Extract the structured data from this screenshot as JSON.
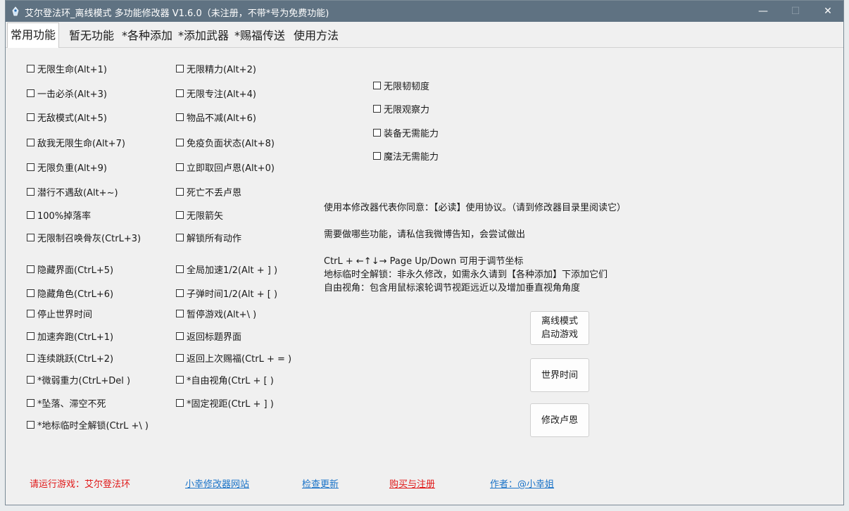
{
  "window": {
    "title": "艾尔登法环_离线模式 多功能修改器  V1.6.0（未注册，不带*号为免费功能)",
    "icon": "app-icon",
    "controls": {
      "minimize": "—",
      "maximize": "☐",
      "close": "✕"
    },
    "colors": {
      "titlebar": "#5f7282",
      "link": "#1a73c8",
      "warn": "#e01818"
    }
  },
  "tabs": [
    {
      "label": "常用功能",
      "active": true
    },
    {
      "label": "暂无功能"
    },
    {
      "label": "*各种添加"
    },
    {
      "label": "*添加武器"
    },
    {
      "label": "*赐福传送"
    },
    {
      "label": "使用方法"
    }
  ],
  "col1": [
    "无限生命(Alt+1)",
    "一击必杀(Alt+3)",
    "无敌模式(Alt+5)",
    "敌我无限生命(Alt+7)",
    "无限负重(Alt+9)",
    "潜行不遇敌(Alt+~)",
    "100%掉落率",
    "无限制召唤骨灰(CtrL+3)",
    "隐藏界面(CtrL+5)",
    "隐藏角色(CtrL+6)",
    "停止世界时间",
    "加速奔跑(CtrL+1)",
    "连续跳跃(CtrL+2)",
    "*微弱重力(CtrL+Del )",
    "*坠落、滞空不死",
    "*地标临时全解锁(CtrL +\\ )"
  ],
  "col2": [
    "无限精力(Alt+2)",
    "无限专注(Alt+4)",
    "物品不减(Alt+6)",
    "免疫负面状态(Alt+8)",
    "立即取回卢恩(Alt+0)",
    "死亡不丢卢恩",
    "无限箭矢",
    "解锁所有动作",
    "全局加速1/2(Alt + ] )",
    "子弹时间1/2(Alt + [ )",
    "暂停游戏(Alt+\\ )",
    "返回标题界面",
    "返回上次赐福(CtrL + = )",
    "*自由视角(CtrL + [ )",
    "*固定视距(CtrL + ] )"
  ],
  "col3": [
    "无限韧韧度",
    "无限观察力",
    "装备无需能力",
    "魔法无需能力"
  ],
  "info": {
    "agreement": "使用本修改器代表你同意：【必读】使用协议。（请到修改器目录里阅读它）",
    "contact": "需要做哪些功能，请私信我微博告知，会尝试做出",
    "keys": "CtrL + ←↑↓→ Page Up/Down 可用于调节坐标",
    "landmark": "地标临时全解锁：非永久修改，如需永久请到【各种添加】下添加它们",
    "freecam": "自由视角：包含用鼠标滚轮调节视距远近以及增加垂直视角角度"
  },
  "buttons": {
    "launch_line1": "离线模式",
    "launch_line2": "启动游戏",
    "world_time": "世界时间",
    "runes": "修改卢恩"
  },
  "footer": {
    "status": "请运行游戏：艾尔登法环",
    "website": "小幸修改器网站",
    "update": "检查更新",
    "buy": "购买与注册",
    "author": "作者：@小幸姐"
  }
}
